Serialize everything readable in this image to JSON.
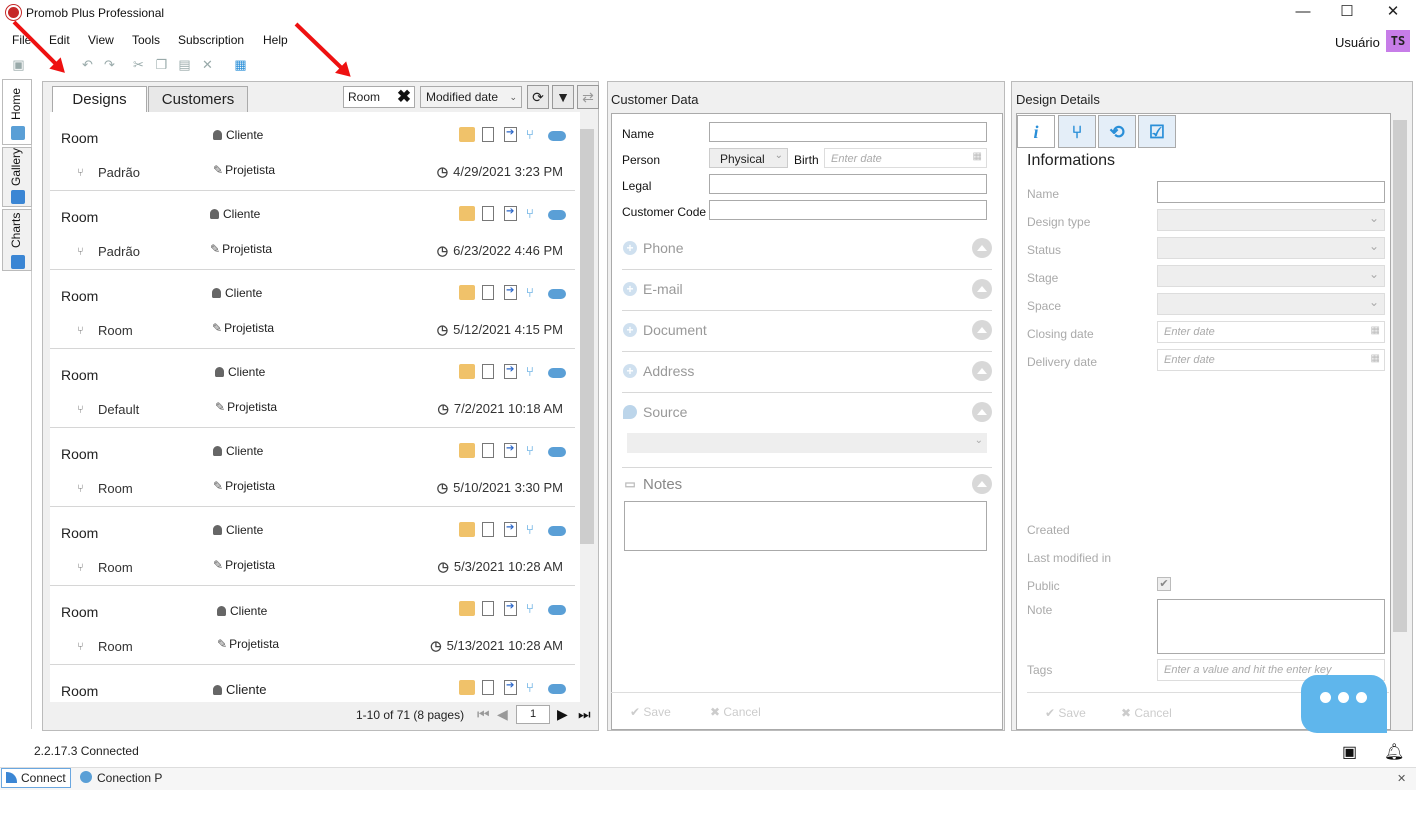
{
  "window": {
    "title": "Promob Plus Professional",
    "minimize": "—",
    "maximize": "☐",
    "close": "✕"
  },
  "menu": [
    "File",
    "Edit",
    "View",
    "Tools",
    "Subscription",
    "Help"
  ],
  "user": {
    "label": "Usuário",
    "initials": "TS"
  },
  "sidebar": {
    "tabs": [
      "Home",
      "Gallery",
      "Charts"
    ]
  },
  "designs": {
    "tabs": [
      "Designs",
      "Customers"
    ],
    "search_value": "Room",
    "sort_label": "Modified date",
    "rows": [
      {
        "title": "Room",
        "client": "Cliente",
        "environment": "Padrão",
        "author": "Projetista",
        "date": "4/29/2021 3:23 PM"
      },
      {
        "title": "Room",
        "client": "Cliente",
        "environment": "Padrão",
        "author": "Projetista",
        "date": "6/23/2022 4:46 PM"
      },
      {
        "title": "Room",
        "client": "Cliente",
        "environment": "Room",
        "author": "Projetista",
        "date": "5/12/2021 4:15 PM"
      },
      {
        "title": "Room",
        "client": "Cliente",
        "environment": "Default",
        "author": "Projetista",
        "date": "7/2/2021 10:18 AM"
      },
      {
        "title": "Room",
        "client": "Cliente",
        "environment": "Room",
        "author": "Projetista",
        "date": "5/10/2021 3:30 PM"
      },
      {
        "title": "Room",
        "client": "Cliente",
        "environment": "Room",
        "author": "Projetista",
        "date": "5/3/2021 10:28 AM"
      },
      {
        "title": "Room",
        "client": "Cliente",
        "environment": "Room",
        "author": "Projetista",
        "date": "5/13/2021 10:28 AM"
      },
      {
        "title": "Room",
        "client": "Cliente",
        "environment": "",
        "author": "",
        "date": ""
      }
    ],
    "pager": {
      "text": "1-10 of 71 (8 pages)",
      "page": "1"
    }
  },
  "customer": {
    "title": "Customer Data",
    "name_label": "Name",
    "person_label": "Person",
    "person_value": "Physical",
    "birth_label": "Birth",
    "birth_placeholder": "Enter date",
    "legal_label": "Legal",
    "code_label": "Customer Code",
    "sections": [
      "Phone",
      "E-mail",
      "Document",
      "Address",
      "Source"
    ],
    "notes_label": "Notes",
    "save": "Save",
    "cancel": "Cancel"
  },
  "details": {
    "title": "Design Details",
    "subtitle": "Informations",
    "fields": [
      "Name",
      "Design type",
      "Status",
      "Stage",
      "Space",
      "Closing date",
      "Delivery date"
    ],
    "date_placeholder": "Enter date",
    "created": "Created",
    "last_modified": "Last modified in",
    "public": "Public",
    "note": "Note",
    "tags": "Tags",
    "tags_placeholder": "Enter a value and hit the enter key",
    "save": "Save",
    "cancel": "Cancel"
  },
  "status": {
    "version": "2.2.17.3",
    "state": "Connected"
  },
  "bottom": {
    "connect": "Connect",
    "connection": "Conection P"
  },
  "colors": {
    "accent": "#2a8fd8",
    "annotation": "#e11111",
    "avatar": "#c77de8",
    "chat": "#5fb6ec"
  }
}
